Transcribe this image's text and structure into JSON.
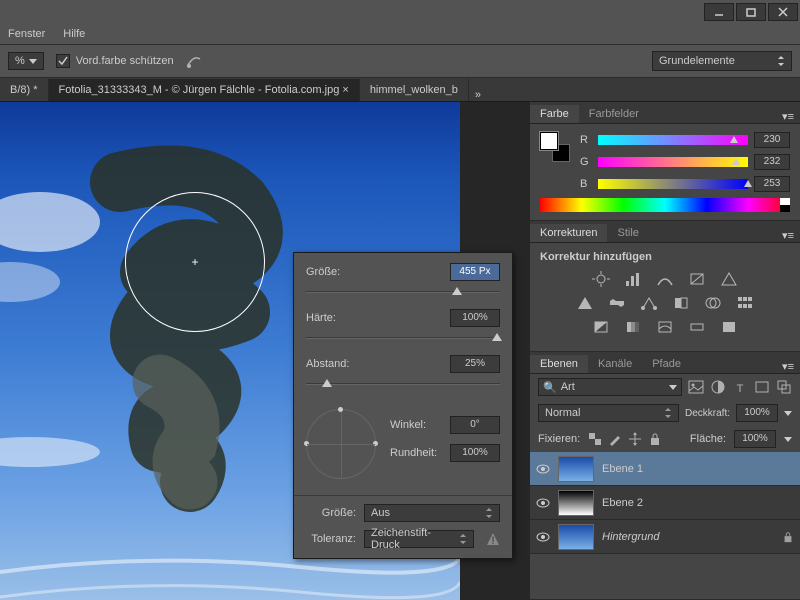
{
  "menu": {
    "fenster": "Fenster",
    "hilfe": "Hilfe"
  },
  "options": {
    "pct_suffix": "%",
    "vordfarbe": "Vord.farbe schützen",
    "workspace": "Grundelemente"
  },
  "tabs": [
    {
      "label": "B/8) *"
    },
    {
      "label": "Fotolia_31333343_M - © Jürgen Fälchle - Fotolia.com.jpg  ×"
    },
    {
      "label": "himmel_wolken_b"
    }
  ],
  "brush": {
    "groesse_label": "Größe:",
    "groesse_val": "455 Px",
    "haerte_label": "Härte:",
    "haerte_val": "100%",
    "abstand_label": "Abstand:",
    "abstand_val": "25%",
    "winkel_label": "Winkel:",
    "winkel_val": "0°",
    "rundheit_label": "Rundheit:",
    "rundheit_val": "100%",
    "groesse2_label": "Größe:",
    "groesse2_val": "Aus",
    "toleranz_label": "Toleranz:",
    "toleranz_val": "Zeichenstift-Druck"
  },
  "panels": {
    "farbe": {
      "tab1": "Farbe",
      "tab2": "Farbfelder",
      "r": "R",
      "g": "G",
      "b": "B",
      "rv": "230",
      "gv": "232",
      "bv": "253"
    },
    "korr": {
      "tab1": "Korrekturen",
      "tab2": "Stile",
      "title": "Korrektur hinzufügen"
    },
    "ebenen": {
      "tab1": "Ebenen",
      "tab2": "Kanäle",
      "tab3": "Pfade",
      "search": "Art",
      "blend": "Normal",
      "deckkraft_label": "Deckkraft:",
      "deckkraft": "100%",
      "fixieren": "Fixieren:",
      "flaeche_label": "Fläche:",
      "flaeche": "100%",
      "layers": [
        {
          "name": "Ebene 1"
        },
        {
          "name": "Ebene 2"
        },
        {
          "name": "Hintergrund"
        }
      ]
    }
  }
}
